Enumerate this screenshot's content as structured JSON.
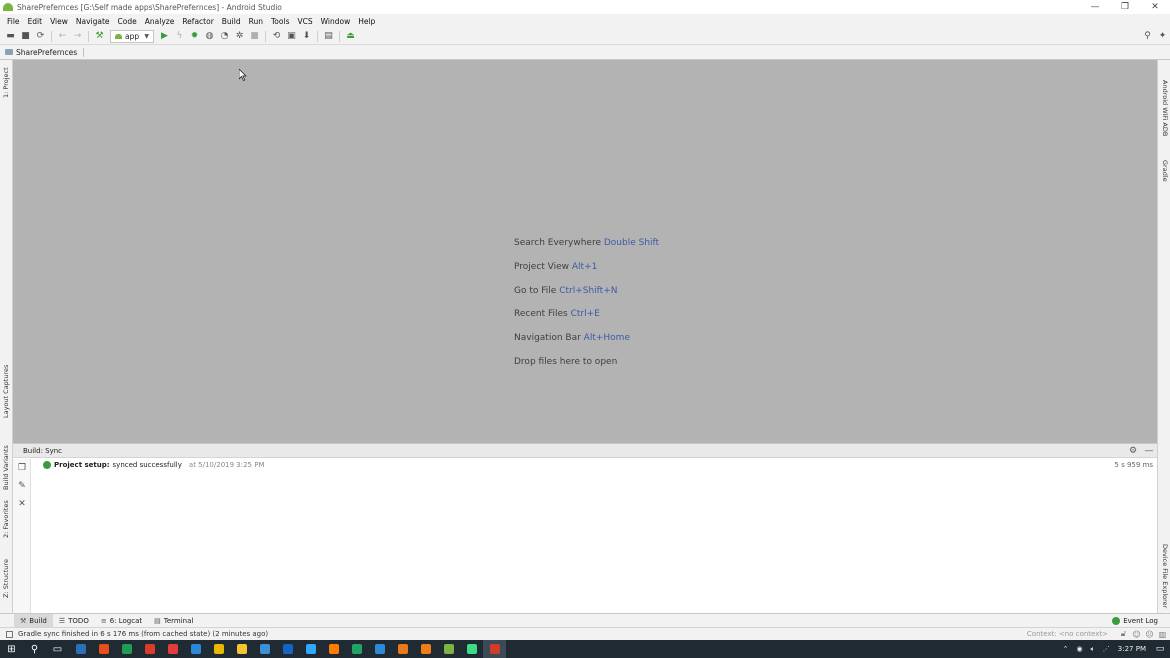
{
  "window": {
    "title": "SharePrefernces [G:\\Self made apps\\SharePrefernces] - Android Studio",
    "controls": [
      "—",
      "❐",
      "✕"
    ]
  },
  "menu": [
    "File",
    "Edit",
    "View",
    "Navigate",
    "Code",
    "Analyze",
    "Refactor",
    "Build",
    "Run",
    "Tools",
    "VCS",
    "Window",
    "Help"
  ],
  "toolbar": {
    "run_config": "app"
  },
  "breadcrumb": {
    "project": "SharePrefernces"
  },
  "left_stripe": {
    "project": "1: Project",
    "layout_captures": "Layout Captures",
    "build_variants": "Build Variants",
    "favorites": "2: Favorites",
    "structure": "Z: Structure"
  },
  "right_stripe": {
    "wifi_adb": "Android WiFi ADB",
    "gradle": "Gradle",
    "device_explorer": "Device File Explorer"
  },
  "editor_hints": [
    {
      "text": "Search Everywhere",
      "key": "Double Shift"
    },
    {
      "text": "Project View",
      "key": "Alt+1"
    },
    {
      "text": "Go to File",
      "key": "Ctrl+Shift+N"
    },
    {
      "text": "Recent Files",
      "key": "Ctrl+E"
    },
    {
      "text": "Navigation Bar",
      "key": "Alt+Home"
    },
    {
      "text": "Drop files here to open",
      "key": ""
    }
  ],
  "build_panel": {
    "tab": "Build: Sync",
    "row": {
      "label": "Project setup:",
      "message": "synced successfully",
      "time": "at 5/10/2019 3:25 PM",
      "duration": "5 s 959 ms"
    }
  },
  "bottom_tabs": {
    "build": "Build",
    "todo": "TODO",
    "logcat": "6: Logcat",
    "terminal": "Terminal",
    "event_log": "Event Log"
  },
  "status": {
    "message": "Gradle sync finished in 6 s 176 ms (from cached state) (2 minutes ago)",
    "context": "Context: <no context>"
  },
  "taskbar": {
    "time": "3:27 PM",
    "app_colors": [
      "#2d6fb7",
      "#e94f1b",
      "#1e9e52",
      "#db3b2a",
      "#e23d3d",
      "#2b88d8",
      "#e6b800",
      "#f4c430",
      "#3d8fd6",
      "#1565c0",
      "#31a8ff",
      "#ff7c00",
      "#21a366",
      "#2e8ad8",
      "#e8791d",
      "#f07c1a",
      "#7cb342",
      "#3ddc84",
      "#d33b2b"
    ]
  }
}
